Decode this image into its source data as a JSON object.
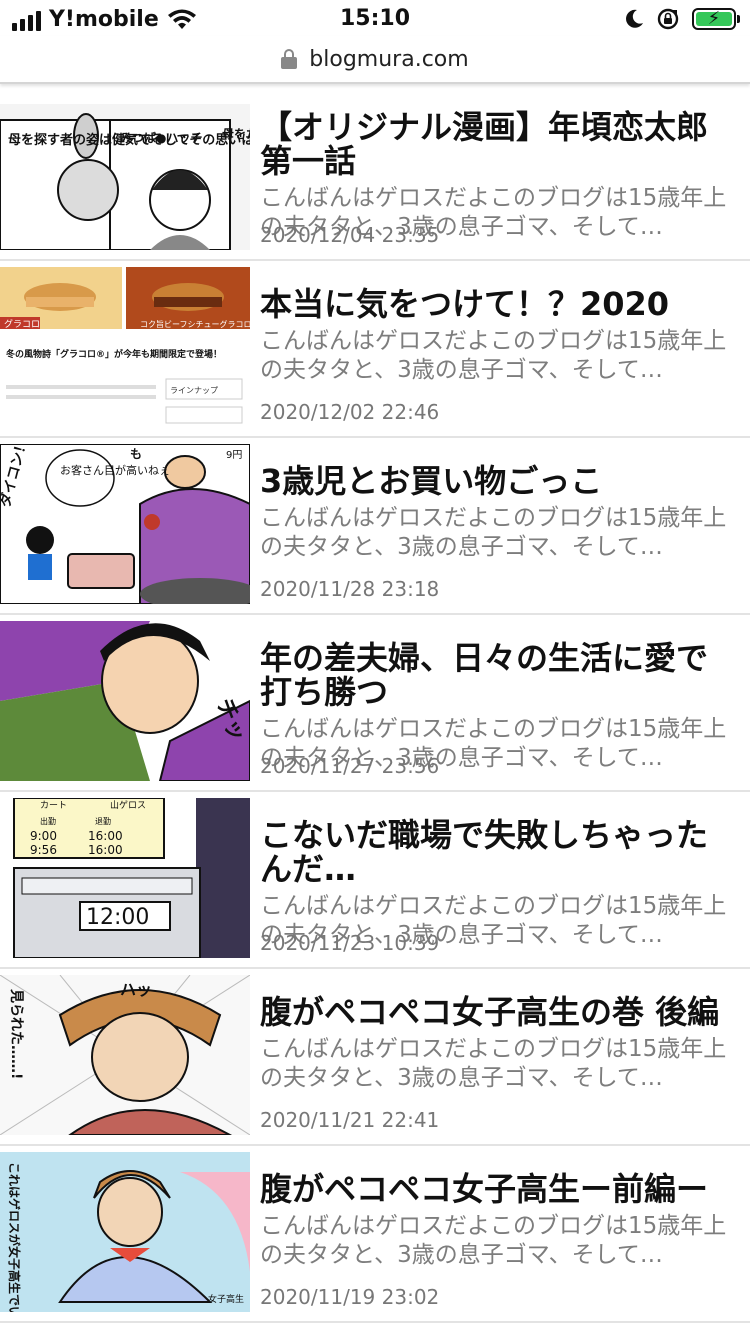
{
  "status": {
    "carrier": "Y!mobile",
    "time": "15:10"
  },
  "browser": {
    "url": "blogmura.com"
  },
  "entries": [
    {
      "title": "【オリジナル漫画】年頃恋太郎第一話",
      "excerpt": "こんばんはゲロスだよこのブログは15歳年上の夫タタと、3歳の息子ゴマ、そして…",
      "date": "2020/12/04 23:35",
      "thumb_text": [
        "母を探す者の姿は健気でそしてその思いは必ずや報われる…!",
        "みつば●ハッチ",
        "母をたずねて●千里"
      ]
    },
    {
      "title": "本当に気をつけて！？2020",
      "excerpt": "こんばんはゲロスだよこのブログは15歳年上の夫タタと、3歳の息子ゴマ、そして…",
      "date": "2020/12/02 22:46",
      "thumb_text": [
        "グラコロ",
        "コク旨ビーフシチューグラコロ",
        "冬の風物詩「グラコロ®」が今年も期間限定で登場！",
        "ラインナップ"
      ]
    },
    {
      "title": "3歳児とお買い物ごっこ",
      "excerpt": "こんばんはゲロスだよこのブログは15歳年上の夫タタと、3歳の息子ゴマ、そして…",
      "date": "2020/11/28 23:18",
      "thumb_text": [
        "ダイコン！",
        "お客さん目が高いねぇ",
        "9円",
        "も"
      ]
    },
    {
      "title": "年の差夫婦、日々の生活に愛で打ち勝つ",
      "excerpt": "こんばんはゲロスだよこのブログは15歳年上の夫タタと、3歳の息子ゴマ、そして…",
      "date": "2020/11/27 23:56",
      "thumb_text": [
        "チッ"
      ]
    },
    {
      "title": "こないだ職場で失敗しちゃったんだ…",
      "excerpt": "こんばんはゲロスだよこのブログは15歳年上の夫タタと、3歳の息子ゴマ、そして…",
      "date": "2020/11/23 10:39",
      "thumb_text": [
        "カート",
        "山ゲロス",
        "出勤",
        "退勤",
        "9:00",
        "16:00",
        "9:56",
        "16:00",
        "12:00"
      ]
    },
    {
      "title": "腹がペコペコ女子高生の巻 後編",
      "excerpt": "こんばんはゲロスだよこのブログは15歳年上の夫タタと、3歳の息子ゴマ、そして…",
      "date": "2020/11/21 22:41",
      "thumb_text": [
        "見られた……!",
        "ハッ"
      ]
    },
    {
      "title": "腹がペコペコ女子高生ー前編ー",
      "excerpt": "こんばんはゲロスだよこのブログは15歳年上の夫タタと、3歳の息子ゴマ、そして…",
      "date": "2020/11/19 23:02",
      "thumb_text": [
        "これはゲロスが女子高生でいじらしい時",
        "女子高生"
      ]
    }
  ],
  "colors": {
    "title": "#111111",
    "excerpt": "#7d7d7d",
    "date": "#777777",
    "divider": "#e3e3e3",
    "battery": "#35c759"
  }
}
